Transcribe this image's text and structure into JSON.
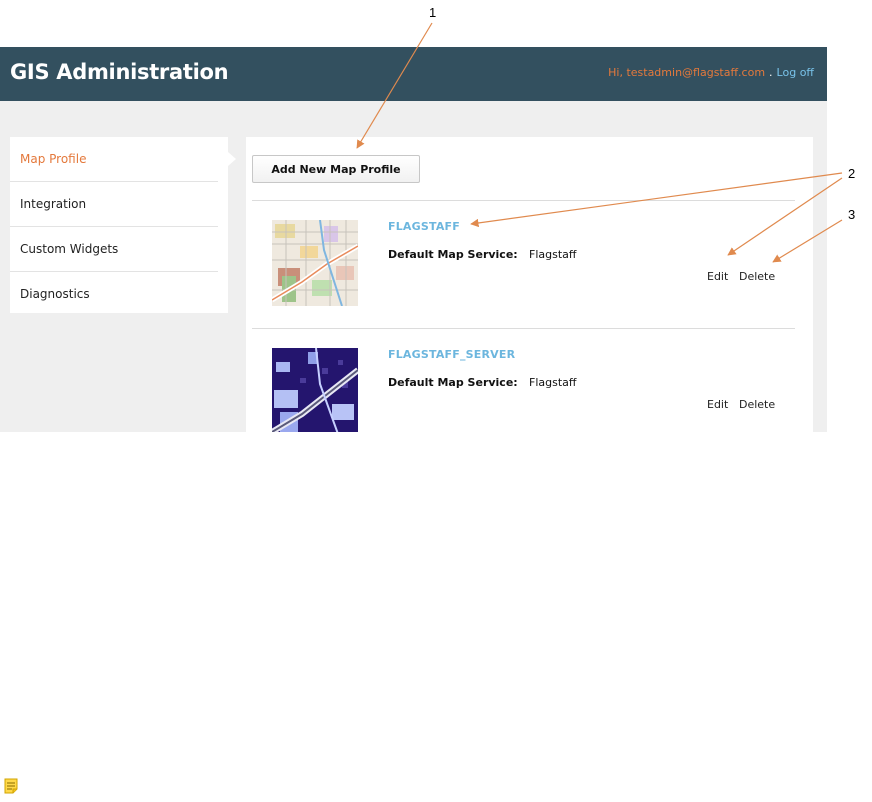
{
  "header": {
    "app_title": "GIS Administration",
    "greeting": "Hi, testadmin@flagstaff.com",
    "separator": ".",
    "logoff": "Log off"
  },
  "sidebar": {
    "items": [
      {
        "label": "Map Profile",
        "active": true
      },
      {
        "label": "Integration",
        "active": false
      },
      {
        "label": "Custom Widgets",
        "active": false
      },
      {
        "label": "Diagnostics",
        "active": false
      }
    ]
  },
  "main": {
    "add_button_label": "Add New Map Profile",
    "profiles": [
      {
        "name": "FLAGSTAFF",
        "service_label": "Default Map Service:",
        "service_value": "Flagstaff",
        "edit_label": "Edit",
        "delete_label": "Delete",
        "thumbnail": "light-street-map-thumbnail"
      },
      {
        "name": "FLAGSTAFF_SERVER",
        "service_label": "Default Map Service:",
        "service_value": "Flagstaff",
        "edit_label": "Edit",
        "delete_label": "Delete",
        "thumbnail": "dark-blue-map-thumbnail"
      }
    ]
  },
  "callouts": [
    "1",
    "2",
    "3"
  ],
  "colors": {
    "header_bg": "#33505f",
    "accent_orange": "#e4793c",
    "link_blue": "#6cb6de",
    "arrow": "#e08a4e"
  },
  "icons": {
    "footer_note": "note-icon"
  }
}
